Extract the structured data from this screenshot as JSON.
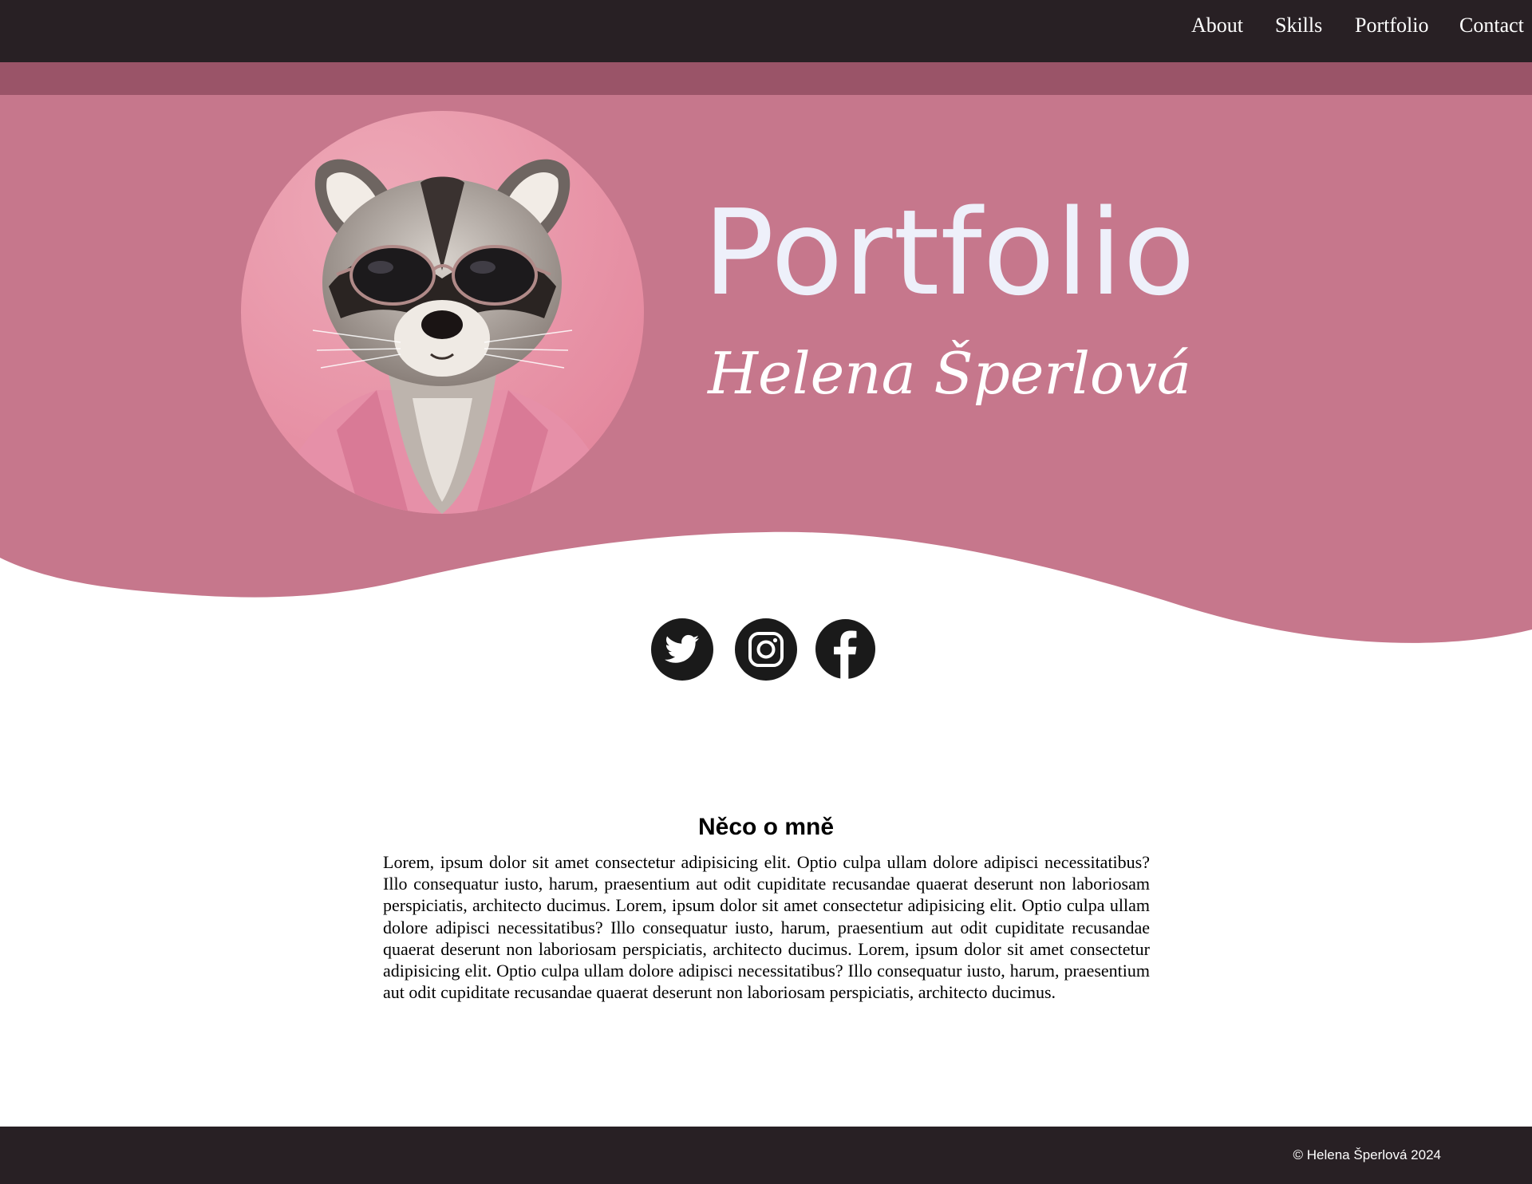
{
  "nav": {
    "items": [
      {
        "label": "About"
      },
      {
        "label": "Skills"
      },
      {
        "label": "Portfolio"
      },
      {
        "label": "Contact"
      }
    ]
  },
  "hero": {
    "title": "Portfolio",
    "subtitle": "Helena Šperlová",
    "avatar_icon": "raccoon-with-sunglasses-photo"
  },
  "social": [
    {
      "icon": "twitter-icon"
    },
    {
      "icon": "instagram-icon"
    },
    {
      "icon": "facebook-icon"
    }
  ],
  "about": {
    "heading": "Něco o mně",
    "text": "Lorem, ipsum dolor sit amet consectetur adipisicing elit. Optio culpa ullam dolore adipisci necessitatibus? Illo consequatur iusto, harum, praesentium aut odit cupiditate recusandae quaerat deserunt non laboriosam perspiciatis, architecto ducimus. Lorem, ipsum dolor sit amet consectetur adipisicing elit. Optio culpa ullam dolore adipisci necessitatibus? Illo consequatur iusto, harum, praesentium aut odit cupiditate recusandae quaerat deserunt non laboriosam perspiciatis, architecto ducimus. Lorem, ipsum dolor sit amet consectetur adipisicing elit. Optio culpa ullam dolore adipisci necessitatibus? Illo consequatur iusto, harum, praesentium aut odit cupiditate recusandae quaerat deserunt non laboriosam perspiciatis, architecto ducimus."
  },
  "footer": {
    "copyright": "© Helena Šperlová 2024"
  },
  "colors": {
    "nav_bg": "#282024",
    "subbar": "#9a5468",
    "hero_pink": "#c6778c",
    "title_color": "#eef0fa",
    "icon_dark": "#1a1a1a"
  }
}
